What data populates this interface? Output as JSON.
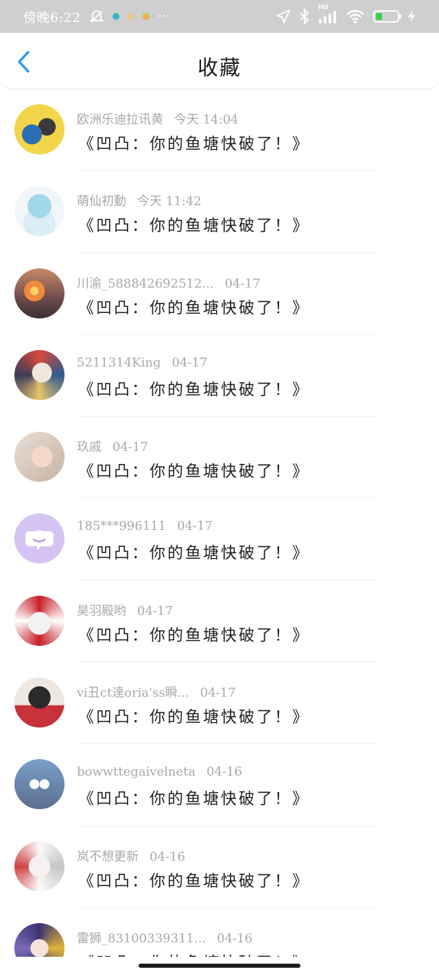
{
  "status_bar": {
    "time": "傍晚6:22",
    "more": "···",
    "hd": "HD",
    "battery_level": 0.3,
    "battery_color": "#36d24d",
    "icons": [
      "mute-icon",
      "app-notify-icon",
      "location-icon",
      "bluetooth-icon",
      "signal-icon",
      "wifi-icon",
      "battery-icon",
      "charging-icon"
    ]
  },
  "header": {
    "title": "收藏",
    "back_icon": "chevron-left-icon",
    "accent": "#2f9bf0"
  },
  "favorites": [
    {
      "name": "欧洲乐迪拉讯黄",
      "time": "今天 14:04",
      "message": "《凹凸：你的鱼塘快破了！》"
    },
    {
      "name": "萌仙初動",
      "time": "今天 11:42",
      "message": "《凹凸：你的鱼塘快破了！》"
    },
    {
      "name": "川渝_58884269​2512...",
      "time": "04-17",
      "message": "《凹凸：你的鱼塘快破了！》"
    },
    {
      "name": "5211314King",
      "time": "04-17",
      "message": "《凹凸：你的鱼塘快破了！》"
    },
    {
      "name": "玖戚",
      "time": "04-17",
      "message": "《凹凸：你的鱼塘快破了！》"
    },
    {
      "name": "185***996111",
      "time": "04-17",
      "message": "《凹凸：你的鱼塘快破了！》"
    },
    {
      "name": "昊羽殿哟",
      "time": "04-17",
      "message": "《凹凸：你的鱼塘快破了！》"
    },
    {
      "name": "vi丑ct達oria'ss瞬...",
      "time": "04-17",
      "message": "《凹凸：你的鱼塘快破了！》"
    },
    {
      "name": "bowwttegaivelneta",
      "time": "04-16",
      "message": "《凹凸：你的鱼塘快破了！》"
    },
    {
      "name": "岚不想更新",
      "time": "04-16",
      "message": "《凹凸：你的鱼塘快破了！》"
    },
    {
      "name": "雷狮_83100339311...",
      "time": "04-16",
      "message": "《凹凸：你的鱼塘快破了！》"
    }
  ]
}
